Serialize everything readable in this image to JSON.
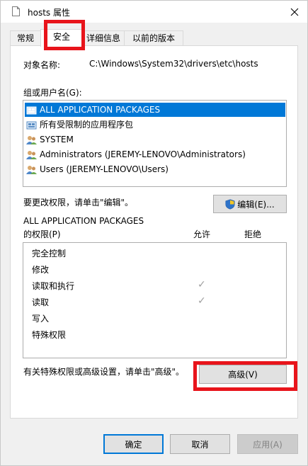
{
  "title": {
    "text": "hosts 属性"
  },
  "tabs": [
    "常规",
    "安全",
    "详细信息",
    "以前的版本"
  ],
  "security": {
    "object_label": "对象名称:",
    "object_value": "C:\\Windows\\System32\\drivers\\etc\\hosts",
    "group_label": "组或用户名(G):",
    "users": [
      "ALL APPLICATION PACKAGES",
      "所有受限制的应用程序包",
      "SYSTEM",
      "Administrators (JEREMY-LENOVO\\Administrators)",
      "Users (JEREMY-LENOVO\\Users)"
    ],
    "edit_hint": "要更改权限，请单击\"编辑\"。",
    "edit_button": "编辑(E)...",
    "perm_for": "ALL APPLICATION PACKAGES",
    "perm_label": "的权限(P)",
    "allow_header": "允许",
    "deny_header": "拒绝",
    "permissions": [
      {
        "name": "完全控制",
        "allow": false,
        "deny": false
      },
      {
        "name": "修改",
        "allow": false,
        "deny": false
      },
      {
        "name": "读取和执行",
        "allow": true,
        "deny": false
      },
      {
        "name": "读取",
        "allow": true,
        "deny": false
      },
      {
        "name": "写入",
        "allow": false,
        "deny": false
      },
      {
        "name": "特殊权限",
        "allow": false,
        "deny": false
      }
    ],
    "advanced_hint": "有关特殊权限或高级设置，请单击\"高级\"。",
    "advanced_button": "高级(V)"
  },
  "footer": {
    "ok": "确定",
    "cancel": "取消",
    "apply": "应用(A)"
  },
  "check_mark": "✓",
  "colors": {
    "selection": "#0078d7",
    "highlight_box": "#e8141b",
    "check": "#a0a0a0"
  }
}
